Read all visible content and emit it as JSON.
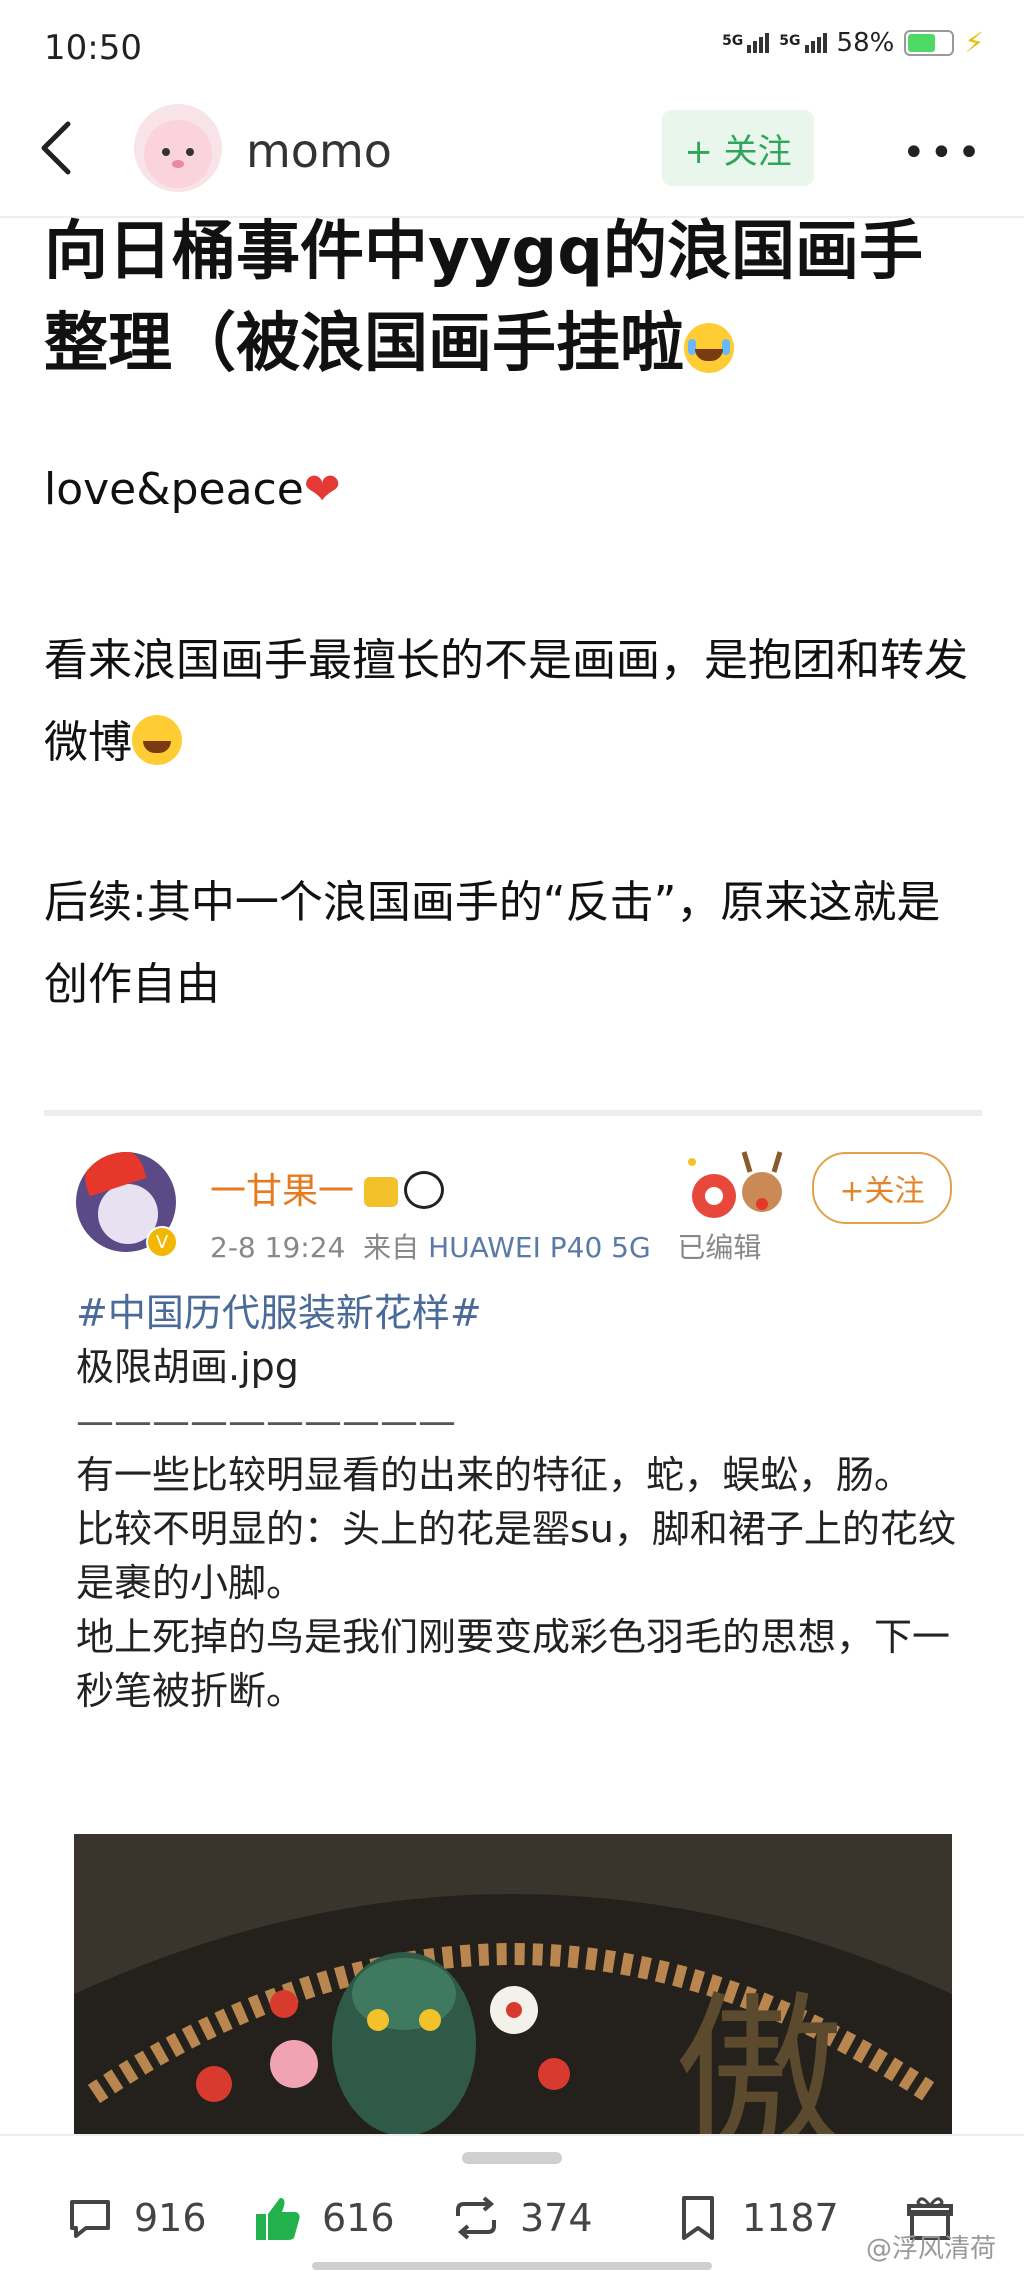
{
  "status": {
    "time": "10:50",
    "net1": "5G",
    "net2": "5G",
    "battery": "58%",
    "battery_level": 0.58
  },
  "header": {
    "username": "momo",
    "follow": "+ 关注"
  },
  "post": {
    "title": "向日桶事件中yygq的浪国画手整理（被浪国画手挂啦",
    "para1": "love&peace",
    "para2": "看来浪国画手最擅长的不是画画，是抱团和转发微博",
    "para3": "后续:其中一个浪国画手的“反击”，原来这就是创作自由"
  },
  "embedded": {
    "name": "一甘果一",
    "time": "2-8 19:24",
    "from": "来自",
    "device": "HUAWEI P40 5G",
    "edited": "已编辑",
    "follow": "+关注",
    "verified_badge": "V",
    "hashtag": "#中国历代服装新花样#",
    "line1": "极限胡画.jpg",
    "line2": "——————————",
    "line3": "有一些比较明显看的出来的特征，蛇，蜈蚣，肠。",
    "line4": "比较不明显的：头上的花是罂su，脚和裙子上的花纹是裹的小脚。",
    "line5": "地上死掉的鸟是我们刚要变成彩色羽毛的思想，下一秒笔被折断。"
  },
  "actions": {
    "comments": "916",
    "likes": "616",
    "reposts": "374",
    "favorites": "1187"
  },
  "watermark": "@浮风清荷",
  "colors": {
    "follow_green": "#2fa45a",
    "like_green": "#22b14c",
    "name_orange": "#e67a1c",
    "tag_blue": "#4a6a9a"
  }
}
